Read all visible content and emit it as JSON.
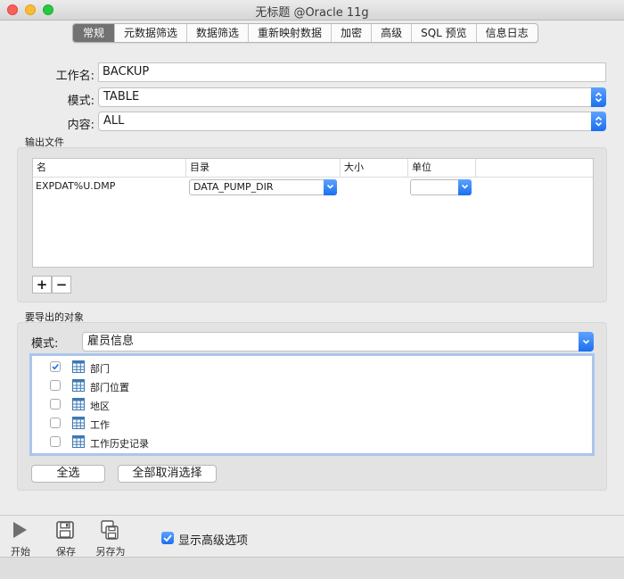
{
  "window": {
    "title": "无标题 @Oracle 11g"
  },
  "tabs": [
    {
      "label": "常规",
      "active": true
    },
    {
      "label": "元数据筛选"
    },
    {
      "label": "数据筛选"
    },
    {
      "label": "重新映射数据"
    },
    {
      "label": "加密"
    },
    {
      "label": "高级"
    },
    {
      "label": "SQL 预览"
    },
    {
      "label": "信息日志"
    }
  ],
  "form": {
    "job_name_label": "工作名:",
    "job_name_value": "BACKUP",
    "mode_label": "模式:",
    "mode_value": "TABLE",
    "content_label": "内容:",
    "content_value": "ALL"
  },
  "output_files": {
    "section_title": "输出文件",
    "columns": [
      "名",
      "目录",
      "大小",
      "单位"
    ],
    "rows": [
      {
        "name": "EXPDAT%U.DMP",
        "directory": "DATA_PUMP_DIR",
        "size": "",
        "unit": ""
      }
    ],
    "add_label": "+",
    "remove_label": "−"
  },
  "objects": {
    "section_title": "要导出的对象",
    "schema_label": "模式:",
    "schema_value": "雇员信息",
    "items": [
      {
        "label": "部门",
        "checked": true
      },
      {
        "label": "部门位置",
        "checked": false
      },
      {
        "label": "地区",
        "checked": false
      },
      {
        "label": "工作",
        "checked": false
      },
      {
        "label": "工作历史记录",
        "checked": false
      }
    ],
    "select_all_label": "全选",
    "deselect_all_label": "全部取消选择"
  },
  "toolbar": {
    "start_label": "开始",
    "save_label": "保存",
    "save_as_label": "另存为",
    "show_advanced_label": "显示高级选项",
    "show_advanced_checked": true
  },
  "colors": {
    "accent": "#1a6ff0",
    "list_focus": "#a9c6ec",
    "active_tab": "#727272"
  }
}
